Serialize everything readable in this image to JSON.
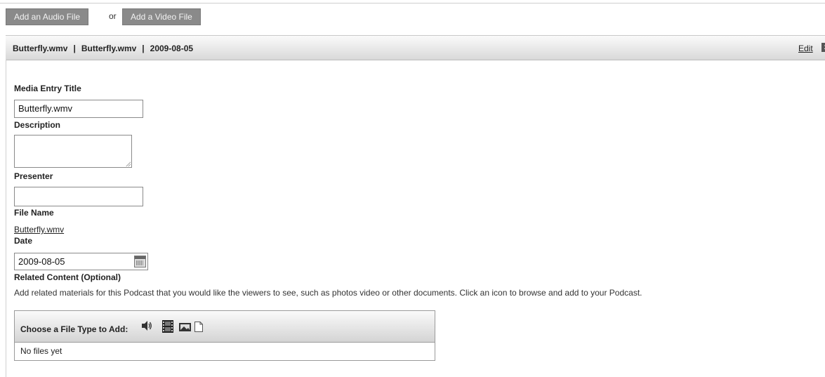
{
  "toolbar": {
    "add_audio_label": "Add an Audio File",
    "or_label": "or",
    "add_video_label": "Add a Video File"
  },
  "entry_bar": {
    "name": "Butterfly.wmv",
    "separator": "|",
    "file": "Butterfly.wmv",
    "date": "2009-08-05",
    "edit_label": "Edit",
    "close_label": "x"
  },
  "form": {
    "title_label": "Media Entry Title",
    "title_value": "Butterfly.wmv",
    "description_label": "Description",
    "description_value": "",
    "presenter_label": "Presenter",
    "presenter_value": "",
    "file_name_label": "File Name",
    "file_name_value": "Butterfly.wmv",
    "date_label": "Date",
    "date_value": "2009-08-05",
    "related_label": "Related Content (Optional)",
    "related_help": "Add related materials for this Podcast that you would like the viewers to see, such as photos video or other documents. Click an icon to browse and add to your Podcast."
  },
  "file_types": {
    "choose_label": "Choose a File Type to Add:",
    "icons": [
      "speaker-icon",
      "film-icon",
      "image-icon",
      "document-icon"
    ],
    "empty_text": "No files yet"
  }
}
